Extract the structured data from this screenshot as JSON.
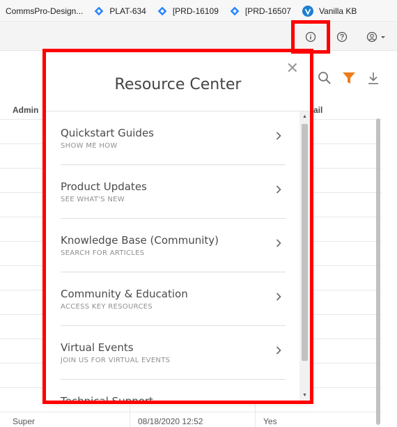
{
  "bookmarks": [
    {
      "label": "CommsPro-Design...",
      "icon": "none"
    },
    {
      "label": "PLAT-634",
      "icon": "jira-diamond-icon"
    },
    {
      "label": "[PRD-16109",
      "icon": "jira-diamond-icon"
    },
    {
      "label": "[PRD-16507",
      "icon": "jira-diamond-icon"
    },
    {
      "label": "Vanilla KB",
      "icon": "vanilla-icon"
    }
  ],
  "topbar": {
    "icons": [
      "info-icon",
      "help-icon",
      "user-menu-icon"
    ]
  },
  "table": {
    "header_admin": "Admin",
    "header_email": "ail",
    "last_row": {
      "role": "Super",
      "date": "08/18/2020 12:52",
      "flag": "Yes"
    }
  },
  "resource_center": {
    "title": "Resource Center",
    "close_icon": "close-icon",
    "items": [
      {
        "title": "Quickstart Guides",
        "subtitle": "SHOW ME HOW"
      },
      {
        "title": "Product Updates",
        "subtitle": "SEE WHAT'S NEW"
      },
      {
        "title": "Knowledge Base (Community)",
        "subtitle": "SEARCH FOR ARTICLES"
      },
      {
        "title": "Community & Education",
        "subtitle": "ACCESS KEY RESOURCES"
      },
      {
        "title": "Virtual Events",
        "subtitle": "JOIN US FOR VIRTUAL EVENTS"
      },
      {
        "title": "Technical Support",
        "subtitle": ""
      }
    ]
  },
  "colors": {
    "highlight": "#ff0000",
    "filter_orange": "#f07b1a",
    "jira_blue": "#2684ff"
  }
}
